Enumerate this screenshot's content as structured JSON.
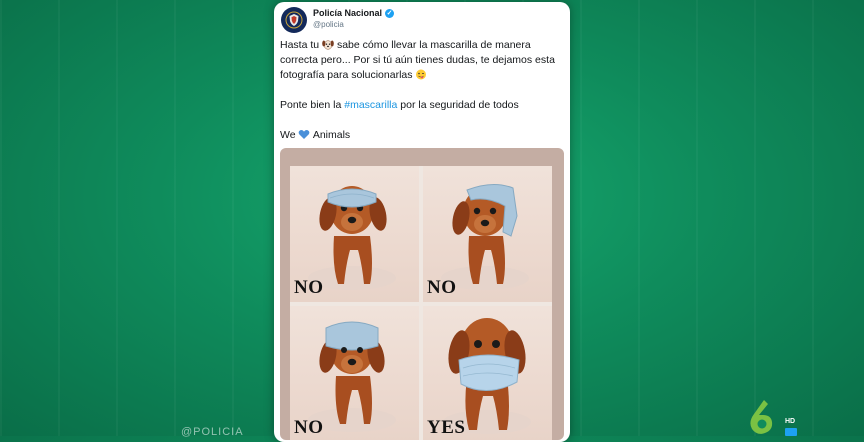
{
  "tweet": {
    "account_name": "Policía Nacional",
    "handle": "@policia",
    "line1_before_emoji": "Hasta tu",
    "line1_after_emoji": "sabe cómo llevar la mascarilla de manera correcta pero... Por si tú aún tienes dudas, te dejamos esta fotografía para solucionarlas",
    "line2_before_hashtag": "Ponte bien la",
    "hashtag": "#mascarilla",
    "line2_after_hashtag": "por la seguridad de todos",
    "line3_before_heart": "We",
    "line3_after_heart": "Animals",
    "emojis": [
      "dog-face-emoji",
      "winking-tongue-emoji",
      "blue-heart-emoji"
    ]
  },
  "photo": {
    "captions": [
      "NO",
      "NO",
      "NO",
      "YES"
    ]
  },
  "overlay": {
    "watermark": "@POLICIA",
    "channel_badge": "HD",
    "channel_logo": "laSexta-6-logo"
  },
  "colors": {
    "background": "#0f8c5c",
    "hashtag": "#1b95e0",
    "verified": "#1da1f2",
    "logo_green": "#7ac143"
  }
}
